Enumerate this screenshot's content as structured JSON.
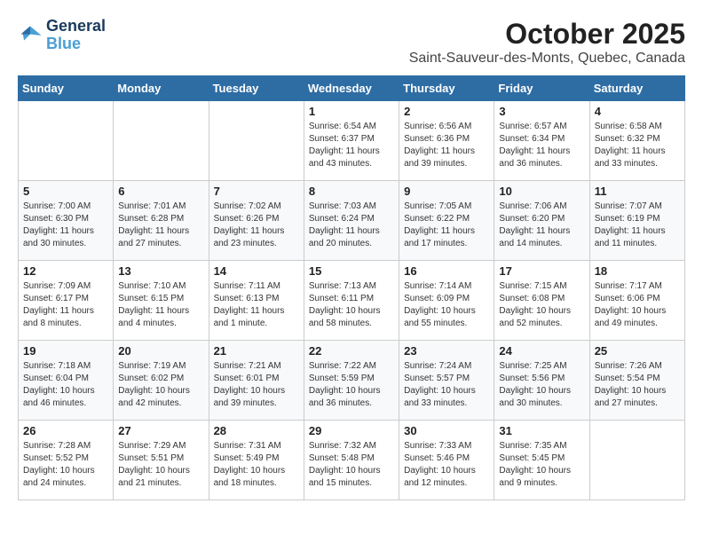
{
  "header": {
    "logo_line1": "General",
    "logo_line2": "Blue",
    "month": "October 2025",
    "location": "Saint-Sauveur-des-Monts, Quebec, Canada"
  },
  "days_of_week": [
    "Sunday",
    "Monday",
    "Tuesday",
    "Wednesday",
    "Thursday",
    "Friday",
    "Saturday"
  ],
  "weeks": [
    [
      {
        "day": "",
        "info": ""
      },
      {
        "day": "",
        "info": ""
      },
      {
        "day": "",
        "info": ""
      },
      {
        "day": "1",
        "info": "Sunrise: 6:54 AM\nSunset: 6:37 PM\nDaylight: 11 hours and 43 minutes."
      },
      {
        "day": "2",
        "info": "Sunrise: 6:56 AM\nSunset: 6:36 PM\nDaylight: 11 hours and 39 minutes."
      },
      {
        "day": "3",
        "info": "Sunrise: 6:57 AM\nSunset: 6:34 PM\nDaylight: 11 hours and 36 minutes."
      },
      {
        "day": "4",
        "info": "Sunrise: 6:58 AM\nSunset: 6:32 PM\nDaylight: 11 hours and 33 minutes."
      }
    ],
    [
      {
        "day": "5",
        "info": "Sunrise: 7:00 AM\nSunset: 6:30 PM\nDaylight: 11 hours and 30 minutes."
      },
      {
        "day": "6",
        "info": "Sunrise: 7:01 AM\nSunset: 6:28 PM\nDaylight: 11 hours and 27 minutes."
      },
      {
        "day": "7",
        "info": "Sunrise: 7:02 AM\nSunset: 6:26 PM\nDaylight: 11 hours and 23 minutes."
      },
      {
        "day": "8",
        "info": "Sunrise: 7:03 AM\nSunset: 6:24 PM\nDaylight: 11 hours and 20 minutes."
      },
      {
        "day": "9",
        "info": "Sunrise: 7:05 AM\nSunset: 6:22 PM\nDaylight: 11 hours and 17 minutes."
      },
      {
        "day": "10",
        "info": "Sunrise: 7:06 AM\nSunset: 6:20 PM\nDaylight: 11 hours and 14 minutes."
      },
      {
        "day": "11",
        "info": "Sunrise: 7:07 AM\nSunset: 6:19 PM\nDaylight: 11 hours and 11 minutes."
      }
    ],
    [
      {
        "day": "12",
        "info": "Sunrise: 7:09 AM\nSunset: 6:17 PM\nDaylight: 11 hours and 8 minutes."
      },
      {
        "day": "13",
        "info": "Sunrise: 7:10 AM\nSunset: 6:15 PM\nDaylight: 11 hours and 4 minutes."
      },
      {
        "day": "14",
        "info": "Sunrise: 7:11 AM\nSunset: 6:13 PM\nDaylight: 11 hours and 1 minute."
      },
      {
        "day": "15",
        "info": "Sunrise: 7:13 AM\nSunset: 6:11 PM\nDaylight: 10 hours and 58 minutes."
      },
      {
        "day": "16",
        "info": "Sunrise: 7:14 AM\nSunset: 6:09 PM\nDaylight: 10 hours and 55 minutes."
      },
      {
        "day": "17",
        "info": "Sunrise: 7:15 AM\nSunset: 6:08 PM\nDaylight: 10 hours and 52 minutes."
      },
      {
        "day": "18",
        "info": "Sunrise: 7:17 AM\nSunset: 6:06 PM\nDaylight: 10 hours and 49 minutes."
      }
    ],
    [
      {
        "day": "19",
        "info": "Sunrise: 7:18 AM\nSunset: 6:04 PM\nDaylight: 10 hours and 46 minutes."
      },
      {
        "day": "20",
        "info": "Sunrise: 7:19 AM\nSunset: 6:02 PM\nDaylight: 10 hours and 42 minutes."
      },
      {
        "day": "21",
        "info": "Sunrise: 7:21 AM\nSunset: 6:01 PM\nDaylight: 10 hours and 39 minutes."
      },
      {
        "day": "22",
        "info": "Sunrise: 7:22 AM\nSunset: 5:59 PM\nDaylight: 10 hours and 36 minutes."
      },
      {
        "day": "23",
        "info": "Sunrise: 7:24 AM\nSunset: 5:57 PM\nDaylight: 10 hours and 33 minutes."
      },
      {
        "day": "24",
        "info": "Sunrise: 7:25 AM\nSunset: 5:56 PM\nDaylight: 10 hours and 30 minutes."
      },
      {
        "day": "25",
        "info": "Sunrise: 7:26 AM\nSunset: 5:54 PM\nDaylight: 10 hours and 27 minutes."
      }
    ],
    [
      {
        "day": "26",
        "info": "Sunrise: 7:28 AM\nSunset: 5:52 PM\nDaylight: 10 hours and 24 minutes."
      },
      {
        "day": "27",
        "info": "Sunrise: 7:29 AM\nSunset: 5:51 PM\nDaylight: 10 hours and 21 minutes."
      },
      {
        "day": "28",
        "info": "Sunrise: 7:31 AM\nSunset: 5:49 PM\nDaylight: 10 hours and 18 minutes."
      },
      {
        "day": "29",
        "info": "Sunrise: 7:32 AM\nSunset: 5:48 PM\nDaylight: 10 hours and 15 minutes."
      },
      {
        "day": "30",
        "info": "Sunrise: 7:33 AM\nSunset: 5:46 PM\nDaylight: 10 hours and 12 minutes."
      },
      {
        "day": "31",
        "info": "Sunrise: 7:35 AM\nSunset: 5:45 PM\nDaylight: 10 hours and 9 minutes."
      },
      {
        "day": "",
        "info": ""
      }
    ]
  ]
}
